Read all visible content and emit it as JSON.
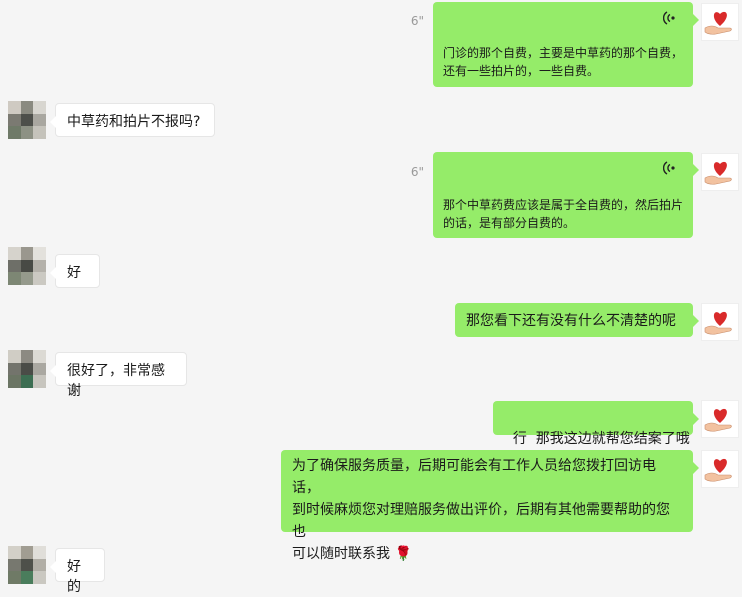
{
  "messages": [
    {
      "side": "me",
      "type": "voice",
      "duration": "6\"",
      "transcript_lines": [
        "门诊的那个自费，主要是中草药的那个自费，",
        "还有一些拍片的，一些自费。"
      ]
    },
    {
      "side": "them",
      "type": "text",
      "text": "中草药和拍片不报吗?"
    },
    {
      "side": "me",
      "type": "voice",
      "duration": "6\"",
      "transcript_lines": [
        "那个中草药费应该是属于全自费的，然后拍片",
        "的话，是有部分自费的。"
      ]
    },
    {
      "side": "them",
      "type": "text",
      "text": "好"
    },
    {
      "side": "me",
      "type": "text",
      "text": "那您看下还有没有什么不清楚的呢"
    },
    {
      "side": "them",
      "type": "text",
      "text": "很好了，非常感谢"
    },
    {
      "side": "me",
      "type": "text",
      "text": "行  那我这边就帮您结案了哦"
    },
    {
      "side": "me",
      "type": "text",
      "lines": [
        "为了确保服务质量，后期可能会有工作人员给您拨打回访电话，",
        "到时候麻烦您对理赔服务做出评价，后期有其他需要帮助的您也",
        "可以随时联系我 🌹"
      ]
    },
    {
      "side": "them",
      "type": "text",
      "text": "好的"
    }
  ],
  "icons": {
    "voice": "voice-wave-icon",
    "my_avatar": "heart-in-hand-avatar",
    "their_avatar": "pixelated-avatar",
    "rose": "rose-emoji"
  },
  "colors": {
    "background": "#f5f5f5",
    "my_bubble": "#95ec69",
    "their_bubble": "#ffffff"
  }
}
